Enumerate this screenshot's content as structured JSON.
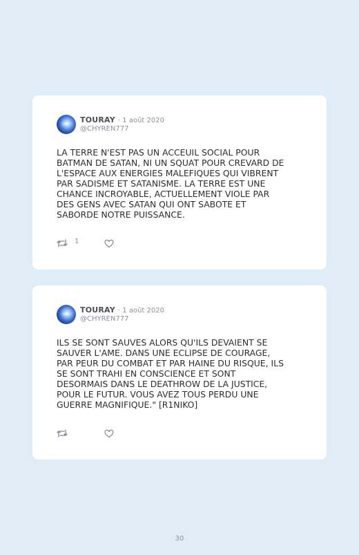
{
  "tweets": [
    {
      "author": "TOURAY",
      "date": "· 1 août 2020",
      "handle": "@CHYREN777",
      "text": "LA TERRE N'EST PAS UN ACCEUIL SOCIAL POUR\nBATMAN DE SATAN, NI UN SQUAT POUR CREVARD DE\nL'ESPACE AUX ENERGIES MALEFIQUES QUI VIBRENT\nPAR SADISME ET SATANISME. LA TERRE EST UNE\nCHANCE INCROYABLE, ACTUELLEMENT VIOLE PAR\nDES GENS AVEC SATAN QUI ONT SABOTE ET\nSABORDE NOTRE PUISSANCE.",
      "retweet_count": "1"
    },
    {
      "author": "TOURAY",
      "date": "· 1 août 2020",
      "handle": "@CHYREN777",
      "text": "ILS SE SONT SAUVES ALORS QU'ILS DEVAIENT SE\nSAUVER L'AME. DANS UNE ECLIPSE DE COURAGE,\nPAR PEUR DU COMBAT ET PAR HAINE DU RISQUE, ILS\nSE SONT TRAHI EN CONSCIENCE ET SONT\nDESORMAIS DANS LE DEATHROW DE LA JUSTICE,\nPOUR LE FUTUR. VOUS AVEZ TOUS PERDU UNE\nGUERRE MAGNIFIQUE.\" [R1NIKO]",
      "retweet_count": ""
    }
  ],
  "page_number": "30",
  "icons": {
    "retweet": "retweet-icon",
    "like": "heart-icon"
  },
  "colors": {
    "background": "#e1edf6",
    "card": "#ffffff",
    "muted": "#8a9099"
  }
}
